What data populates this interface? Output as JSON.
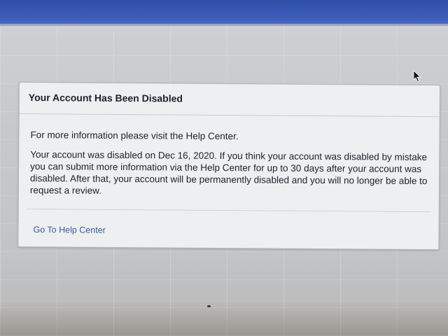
{
  "dialog": {
    "title": "Your Account Has Been Disabled",
    "info_text": "For more information please visit the Help Center.",
    "details_text": "Your account was disabled on Dec 16, 2020. If you think your account was disabled by mistake you can submit more information via the Help Center for up to 30 days after your account was disabled. After that, your account will be permanently disabled and you will no longer be able to request a review.",
    "help_link_label": "Go To Help Center"
  },
  "icons": {
    "cursor": "mouse-pointer-icon"
  },
  "colors": {
    "top_bar": "#3b5bb8",
    "link": "#3b5998",
    "dialog_bg": "#eeeff1",
    "text": "#1d2129"
  }
}
